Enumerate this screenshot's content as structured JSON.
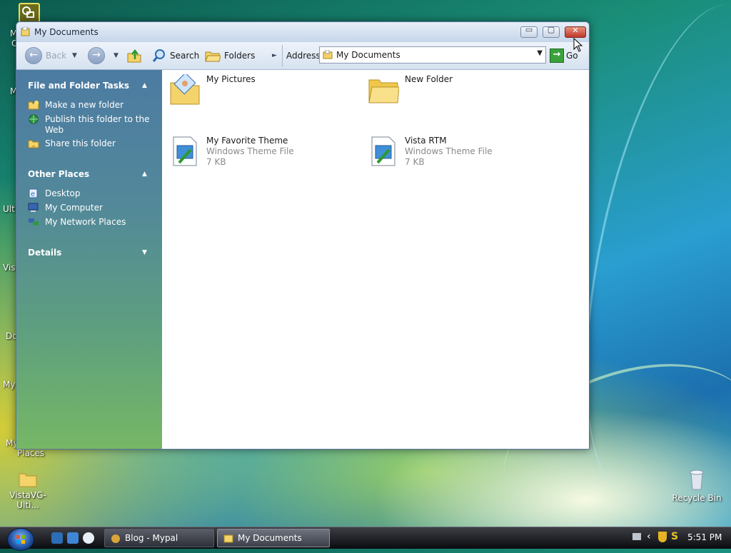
{
  "desktop": {
    "icons": [
      {
        "label": "Recycle Bin"
      },
      {
        "label": "VistaVG-Ulti..."
      }
    ],
    "clipped_labels": [
      "M",
      "C",
      "M",
      "Ulti",
      "Vista",
      "Do",
      "My",
      "My",
      "Places"
    ]
  },
  "window": {
    "title": "My Documents",
    "controls": {
      "minimize": "▭",
      "maximize": "▢",
      "close": "✕"
    }
  },
  "toolbar": {
    "back_label": "Back",
    "search_label": "Search",
    "folders_label": "Folders",
    "address_label": "Address",
    "address_value": "My Documents",
    "go_label": "Go"
  },
  "taskpane": {
    "sections": [
      {
        "title": "File and Folder Tasks",
        "items": [
          {
            "label": "Make a new folder",
            "icon": "new-folder-icon"
          },
          {
            "label": "Publish this folder to the Web",
            "icon": "globe-icon"
          },
          {
            "label": "Share this folder",
            "icon": "share-folder-icon"
          }
        ]
      },
      {
        "title": "Other Places",
        "items": [
          {
            "label": "Desktop",
            "icon": "desktop-icon"
          },
          {
            "label": "My Computer",
            "icon": "computer-icon"
          },
          {
            "label": "My Network Places",
            "icon": "network-icon"
          }
        ]
      },
      {
        "title": "Details",
        "items": []
      }
    ]
  },
  "files": [
    {
      "name": "My Pictures",
      "type": "",
      "size": "",
      "icon": "pictures-folder-icon"
    },
    {
      "name": "New Folder",
      "type": "",
      "size": "",
      "icon": "folder-icon"
    },
    {
      "name": "My Favorite Theme",
      "type": "Windows Theme File",
      "size": "7 KB",
      "icon": "theme-file-icon"
    },
    {
      "name": "Vista RTM",
      "type": "Windows Theme File",
      "size": "7 KB",
      "icon": "theme-file-icon"
    }
  ],
  "taskbar": {
    "buttons": [
      {
        "label": "Blog - Mypal"
      },
      {
        "label": "My Documents"
      }
    ],
    "clock": "5:51 PM"
  },
  "colors": {
    "taskpane_top": "#4c7ba2",
    "taskpane_bottom": "#76b765",
    "close_button": "#c0382a",
    "go_button": "#3aa23a"
  }
}
